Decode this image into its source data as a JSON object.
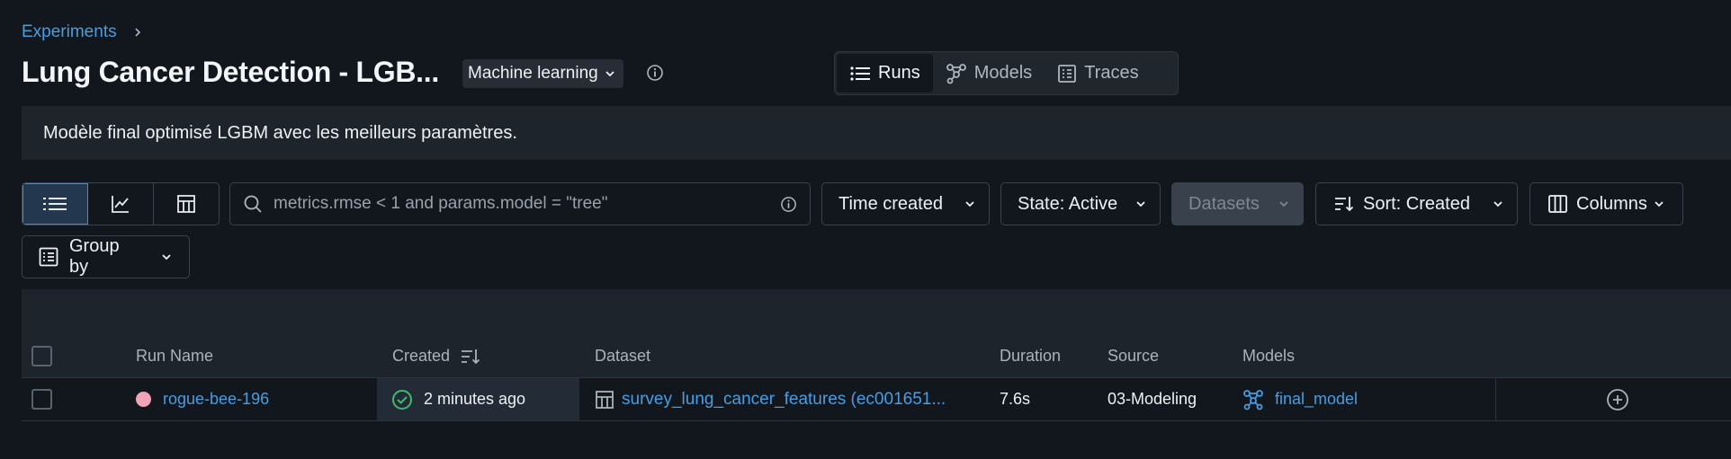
{
  "breadcrumb": {
    "items": [
      "Experiments"
    ]
  },
  "header": {
    "title": "Lung Cancer Detection - LGB...",
    "experiment_type": "Machine learning"
  },
  "view_tabs": [
    {
      "label": "Runs",
      "active": true,
      "icon": "list-icon"
    },
    {
      "label": "Models",
      "active": false,
      "icon": "models-icon"
    },
    {
      "label": "Traces",
      "active": false,
      "icon": "traces-icon"
    }
  ],
  "description": "Modèle final optimisé LGBM avec les meilleurs paramètres.",
  "toolbar": {
    "view_modes": [
      "list-view",
      "chart-view",
      "table-view"
    ],
    "active_view_mode": "list-view",
    "search_placeholder": "metrics.rmse < 1 and params.model = \"tree\"",
    "time_filter": "Time created",
    "state_filter": "State: Active",
    "datasets_filter": "Datasets",
    "sort": "Sort: Created",
    "columns": "Columns",
    "group_by": "Group by"
  },
  "table": {
    "columns": [
      "Run Name",
      "Created",
      "Dataset",
      "Duration",
      "Source",
      "Models"
    ],
    "rows": [
      {
        "run_name": "rogue-bee-196",
        "run_color": "#f2a3b5",
        "created": "2 minutes ago",
        "dataset": "survey_lung_cancer_features (ec001651...",
        "duration": "7.6s",
        "source": "03-Modeling",
        "model": "final_model"
      }
    ]
  },
  "colors": {
    "background": "#11171d",
    "accent": "#4a9de0",
    "success": "#3fb96f"
  }
}
